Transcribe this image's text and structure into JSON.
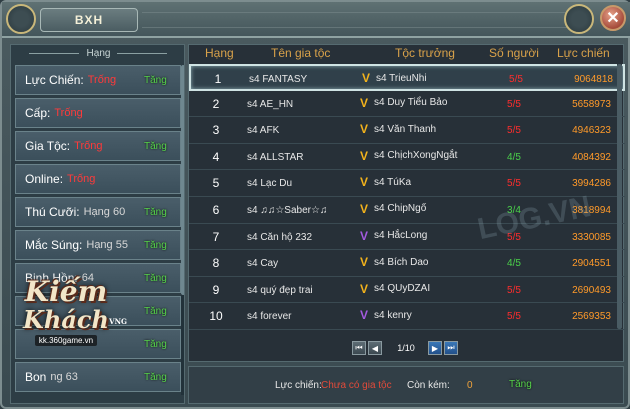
{
  "window": {
    "title": "BXH",
    "close_label": "✕"
  },
  "left_panel": {
    "header": "Hạng",
    "stats": [
      {
        "label": "Lực Chiến:",
        "value": "Trống",
        "has_rank": false,
        "up": "Tăng"
      },
      {
        "label": "Cấp:",
        "value": "Trống",
        "has_rank": false,
        "up": ""
      },
      {
        "label": "Gia Tộc:",
        "value": "Trống",
        "has_rank": false,
        "up": "Tăng"
      },
      {
        "label": "Online:",
        "value": "Trống",
        "has_rank": false,
        "up": ""
      },
      {
        "label": "Thú Cưỡi:",
        "value": "Hạng 60",
        "has_rank": true,
        "up": "Tăng"
      },
      {
        "label": "Mắc Súng:",
        "value": "Hạng 55",
        "has_rank": true,
        "up": "Tăng"
      },
      {
        "label": "Binh Hồn:",
        "value": "64",
        "has_rank": true,
        "up": "Tăng"
      },
      {
        "label": "",
        "value": "",
        "has_rank": true,
        "up": "Tăng"
      },
      {
        "label": "",
        "value": "",
        "has_rank": true,
        "up": "Tăng"
      },
      {
        "label": "Bon",
        "value": "ng 63",
        "has_rank": true,
        "up": "Tăng"
      }
    ]
  },
  "logo": {
    "main": "Kiếm",
    "sub": "Khách",
    "vng": "VNG",
    "url": "kk.360game.vn"
  },
  "table": {
    "headers": {
      "rank": "Hạng",
      "clan": "Tên gia tộc",
      "leader": "Tộc trưởng",
      "members": "Số người",
      "power": "Lực chiến"
    },
    "rows": [
      {
        "rank": "1",
        "clan": "s4 FANTASY",
        "leader": "s4 TrieuNhi",
        "badge": "gold",
        "members": "5/5",
        "members_full": true,
        "power": "9064818"
      },
      {
        "rank": "2",
        "clan": "s4 AE_HN",
        "leader": "s4 Duy Tiểu Bảo",
        "badge": "gold",
        "members": "5/5",
        "members_full": true,
        "power": "5658973"
      },
      {
        "rank": "3",
        "clan": "s4 AFK",
        "leader": "s4 Văn Thanh",
        "badge": "gold",
        "members": "5/5",
        "members_full": true,
        "power": "4946323"
      },
      {
        "rank": "4",
        "clan": "s4 ALLSTAR",
        "leader": "s4 ChịchXongNgắt",
        "badge": "gold",
        "members": "4/5",
        "members_full": false,
        "power": "4084392"
      },
      {
        "rank": "5",
        "clan": "s4 Lạc Du",
        "leader": "s4 TúKa",
        "badge": "gold",
        "members": "5/5",
        "members_full": true,
        "power": "3994286"
      },
      {
        "rank": "6",
        "clan": "s4 ♫♫☆Saber☆♫",
        "leader": "s4 ChipNgố",
        "badge": "gold",
        "members": "3/4",
        "members_full": false,
        "power": "3818994"
      },
      {
        "rank": "7",
        "clan": "s4 Căn hộ 232",
        "leader": "s4 HắcLong",
        "badge": "purple",
        "members": "5/5",
        "members_full": true,
        "power": "3330085"
      },
      {
        "rank": "8",
        "clan": "s4 Cay",
        "leader": "s4 Bích Dao",
        "badge": "gold",
        "members": "4/5",
        "members_full": false,
        "power": "2904551"
      },
      {
        "rank": "9",
        "clan": "s4 quý đẹp trai",
        "leader": "s4 QUyDZAI",
        "badge": "gold",
        "members": "5/5",
        "members_full": true,
        "power": "2690493"
      },
      {
        "rank": "10",
        "clan": "s4 forever",
        "leader": "s4 kenry",
        "badge": "purple",
        "members": "5/5",
        "members_full": true,
        "power": "2569353"
      }
    ]
  },
  "pager": {
    "first": "⏮",
    "prev": "◀",
    "page": "1/10",
    "next": "▶",
    "last": "⏭"
  },
  "bottom": {
    "power_label": "Lực chiến:",
    "power_value": "Chưa có gia tộc",
    "gap_label": "Còn kém:",
    "gap_value": "0",
    "up": "Tăng"
  },
  "watermark": "LOG.VN",
  "colors": {
    "accent_gold": "#d9a24a",
    "rank_red": "#ff3a3a",
    "up_green": "#56d24a",
    "power_orange": "#ff9a2a"
  }
}
